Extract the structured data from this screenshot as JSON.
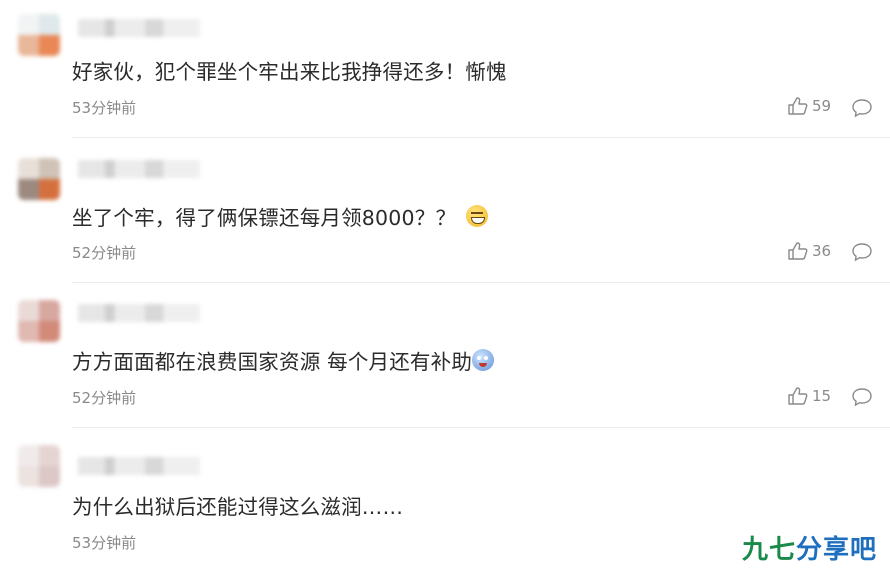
{
  "comments": [
    {
      "text": "好家伙，犯个罪坐个牢出来比我挣得还多！惭愧",
      "time": "53分钟前",
      "likes": "59",
      "emoji": "none"
    },
    {
      "text": "坐了个牢，得了俩保镖还每月领8000？？",
      "time": "52分钟前",
      "likes": "36",
      "emoji": "grin-sweat-emoji"
    },
    {
      "text": "方方面面都在浪费国家资源 每个月还有补助",
      "time": "52分钟前",
      "likes": "15",
      "emoji": "doraemon-emoji"
    },
    {
      "text": "为什么出狱后还能过得这么滋润……",
      "time": "53分钟前",
      "likes": "",
      "emoji": "none"
    }
  ],
  "icons": {
    "like": "thumbs-up-icon",
    "reply": "speech-bubble-icon"
  },
  "watermark": {
    "part1": "九七",
    "part2": "分享吧"
  },
  "colors": {
    "text": "#2b2b2b",
    "meta": "#8a8a8a",
    "divider": "#ebebeb",
    "watermark_green": "#1a8a4a",
    "watermark_blue": "#1f6fbf"
  }
}
